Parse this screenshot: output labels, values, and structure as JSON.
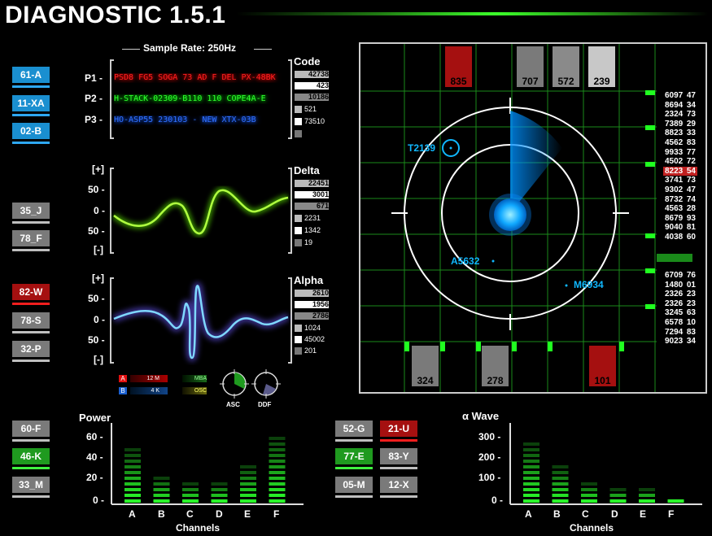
{
  "title": "DIAGNOSTIC 1.5.1",
  "sample_rate": "Sample Rate: 250Hz",
  "left_buttons": [
    {
      "label": "61-A",
      "color": "blue"
    },
    {
      "label": "11-XA",
      "color": "blue"
    },
    {
      "label": "02-B",
      "color": "blue"
    },
    {
      "label": "35_J",
      "color": "gray"
    },
    {
      "label": "78_F",
      "color": "gray"
    },
    {
      "label": "82-W",
      "color": "red"
    },
    {
      "label": "78-S",
      "color": "gray"
    },
    {
      "label": "32-P",
      "color": "gray"
    },
    {
      "label": "60-F",
      "color": "gray"
    },
    {
      "label": "46-K",
      "color": "green"
    },
    {
      "label": "33_M",
      "color": "gray"
    }
  ],
  "code_panel": {
    "channels": [
      "P1 -",
      "P2 -",
      "P3 -"
    ],
    "channel_texts": [
      "PSD8 FG5 SOGA 73 AD F DEL  PX-48BK",
      "H-STACK-02309-B110 110  COPE4A-E",
      "HO-ASP55 230103 - NEW XTX-03B"
    ],
    "header": "Code",
    "numbers": [
      "42738",
      "423",
      "10186",
      "521",
      "73510",
      ""
    ]
  },
  "delta_panel": {
    "header": "Delta",
    "axis": [
      "[+]",
      "50 -",
      "0 -",
      "50 -",
      "[-]"
    ],
    "numbers": [
      "22451",
      "3001",
      "671",
      "2231",
      "1342",
      "19"
    ]
  },
  "alpha_panel": {
    "header": "Alpha",
    "axis": [
      "[+]",
      "50 -",
      "0 -",
      "50 -",
      "[-]"
    ],
    "numbers": [
      "2610",
      "1956",
      "2786",
      "1024",
      "45002",
      "201"
    ]
  },
  "legend": {
    "a_tag": "A",
    "a_val": "12 M",
    "b_tag": "B",
    "b_val": "4 K",
    "mba": "MBA",
    "osc": "OSC",
    "asc": "ASC",
    "ddf": "DDF"
  },
  "radar": {
    "top_bars": [
      "835",
      "707",
      "572",
      "239"
    ],
    "bottom_bars": [
      "324",
      "278",
      "101"
    ],
    "targets": [
      "T2139",
      "A5632",
      "M6934"
    ],
    "table": [
      [
        "6097",
        "47"
      ],
      [
        "8694",
        "34"
      ],
      [
        "2324",
        "73"
      ],
      [
        "7389",
        "29"
      ],
      [
        "8823",
        "33"
      ],
      [
        "4562",
        "83"
      ],
      [
        "9933",
        "77"
      ],
      [
        "4502",
        "72"
      ],
      [
        "8223",
        "54"
      ],
      [
        "3741",
        "73"
      ],
      [
        "9302",
        "47"
      ],
      [
        "8732",
        "74"
      ],
      [
        "4563",
        "28"
      ],
      [
        "8679",
        "93"
      ],
      [
        "9040",
        "81"
      ],
      [
        "4038",
        "60"
      ],
      [
        "6709",
        "76"
      ],
      [
        "1480",
        "01"
      ],
      [
        "2326",
        "23"
      ],
      [
        "2326",
        "23"
      ],
      [
        "3245",
        "63"
      ],
      [
        "6578",
        "10"
      ],
      [
        "7294",
        "83"
      ],
      [
        "9023",
        "34"
      ]
    ]
  },
  "power_chart": {
    "title": "Power",
    "xlabel": "Channels",
    "y_ticks": [
      "60 -",
      "40 -",
      "20 -",
      "0 -"
    ],
    "categories": [
      "A",
      "B",
      "C",
      "D",
      "E",
      "F"
    ]
  },
  "mid_buttons": [
    {
      "label": "52-G",
      "color": "gray"
    },
    {
      "label": "21-U",
      "color": "red"
    },
    {
      "label": "77-E",
      "color": "green"
    },
    {
      "label": "83-Y",
      "color": "gray"
    },
    {
      "label": "05-M",
      "color": "gray"
    },
    {
      "label": "12-X",
      "color": "gray"
    }
  ],
  "wave_chart": {
    "title": "α Wave",
    "xlabel": "Channels",
    "y_ticks": [
      "300 -",
      "200 -",
      "100 -",
      "0 -"
    ],
    "categories": [
      "A",
      "B",
      "C",
      "D",
      "E",
      "F"
    ]
  },
  "chart_data": [
    {
      "type": "bar",
      "title": "Power",
      "xlabel": "Channels",
      "ylabel": "",
      "categories": [
        "A",
        "B",
        "C",
        "D",
        "E",
        "F"
      ],
      "values": [
        55,
        30,
        25,
        23,
        40,
        65
      ],
      "ylim": [
        0,
        70
      ]
    },
    {
      "type": "bar",
      "title": "α Wave",
      "xlabel": "Channels",
      "ylabel": "",
      "categories": [
        "A",
        "B",
        "C",
        "D",
        "E",
        "F"
      ],
      "values": [
        270,
        180,
        120,
        90,
        80,
        30
      ],
      "ylim": [
        0,
        330
      ]
    }
  ]
}
